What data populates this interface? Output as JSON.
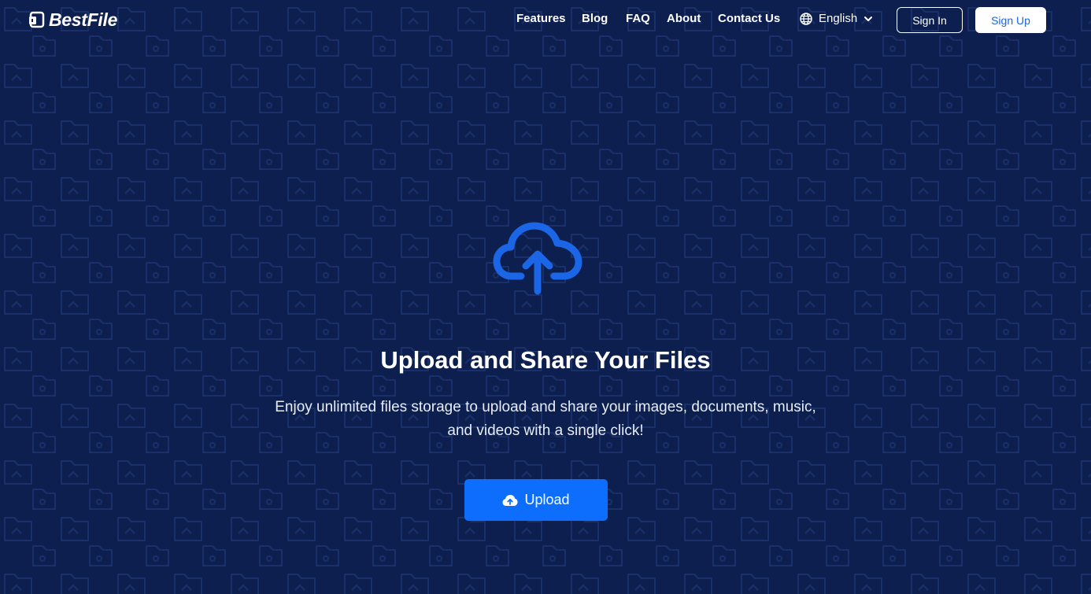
{
  "brand": {
    "name": "BestFile"
  },
  "nav": {
    "links": [
      "Features",
      "Blog",
      "FAQ",
      "About",
      "Contact Us"
    ],
    "language": "English",
    "sign_in": "Sign In",
    "sign_up": "Sign Up"
  },
  "hero": {
    "title": "Upload and Share Your Files",
    "subtitle": "Enjoy unlimited files storage to upload and share your images, documents, music, and videos with a single click!",
    "upload_label": "Upload"
  },
  "icons": {
    "logo": "file-logo-icon",
    "language": "globe-icon",
    "dropdown": "chevron-down-icon",
    "hero": "cloud-upload-icon",
    "upload_button": "cloud-upload-icon"
  },
  "colors": {
    "background": "#0c1f4f",
    "pattern": "#19306a",
    "accent": "#1a66e6",
    "button": "#0d6efd",
    "text": "#ffffff"
  }
}
